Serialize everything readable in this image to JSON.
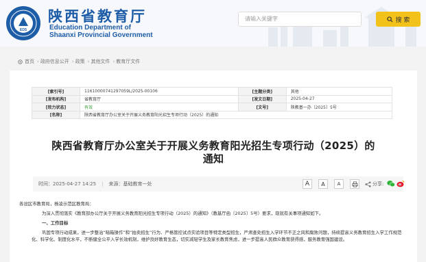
{
  "header": {
    "title_cn": "陕西省教育厅",
    "title_en_line1": "Education Department of",
    "title_en_line2": "Shaanxi Provincial Government",
    "seal_text": "EDS",
    "search": {
      "placeholder": "请输入关键字",
      "button_label": "搜 索"
    }
  },
  "breadcrumb": [
    "首页",
    "政府信息公开",
    "政策",
    "其他文件",
    "教育厅文件"
  ],
  "meta": {
    "rows": [
      {
        "k1": "[索引号]",
        "v1": "11610000741297059L/2025-00106",
        "k2": "[主题分类]",
        "v2": "其他"
      },
      {
        "k1": "[发布机构]",
        "v1": "省教育厅",
        "k2": "[发文日期]",
        "v2": "2025-04-27"
      },
      {
        "k1": "[效力状态]",
        "v1": "有效",
        "k2": "[文号]",
        "v2": "陕教基一办〔2025〕5号"
      }
    ],
    "name_key": "[名称]",
    "name_value": "陕西省教育厅办公室关于开展义务教育阳光招生专项行动（2025）的通知"
  },
  "article": {
    "title_line1": "陕西省教育厅办公室关于开展义务教育阳光招生专项行动（2025）的",
    "title_line2": "通知",
    "time": "时间：2025-04-27 14:25",
    "sep": "|",
    "source": "来源：基础教育一处",
    "font_large": "A",
    "font_medium": "A",
    "font_small": "A",
    "share_label": "分享:",
    "body": {
      "salutation": "各设区市教育局，杨凌示范区教育局：",
      "intro": "为深入贯彻落实《教育部办公厅关于开展义务教育阳光招生专项行动（2025）的通知》（教基厅函〔2025〕5号）要求，现就有关事项通知如下。",
      "h1": "一、工作目标",
      "p1": "巩固专项行动成果，进一步整治“暗箱操作”和“拍卖招生”行为、严格管控试点实验项目等特定类型招生，严肃查处招生入学环节不正之风和腐败问题，持续提高义务教育招生入学工作规范化、科学化、制度化水平，不断健全公平入学长效机制，维护良好教育生态，切实减轻学生及家长教育焦虑，进一步提高人民群众教育获得感，服务教育强国建设。"
    }
  },
  "colors": {
    "brand_blue": "#1d5da8",
    "search_button": "#f2c21b",
    "status_green": "#3a9a3a",
    "wechat_green": "#2fb53a",
    "weibo_red": "#e6162d"
  }
}
